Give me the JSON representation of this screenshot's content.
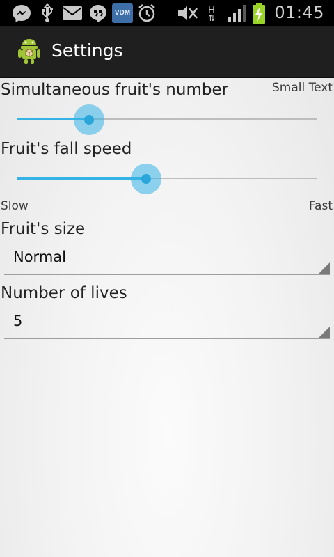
{
  "status_bar": {
    "time": "01:45",
    "icons": [
      "messenger-icon",
      "usb-icon",
      "email-icon",
      "hangouts-icon",
      "vdm-icon",
      "alarm-icon",
      "mute-icon",
      "hspa-icon",
      "signal-icon",
      "battery-charging-icon"
    ],
    "vdm_text": "VDM",
    "hspa_text": "H"
  },
  "action_bar": {
    "title": "Settings"
  },
  "settings": {
    "fruit_number": {
      "label": "Simultaneous fruit's number",
      "value_text": "Small Text",
      "level": 0.24
    },
    "fall_speed": {
      "label": "Fruit's fall speed",
      "level": 0.43,
      "min_label": "Slow",
      "max_label": "Fast"
    },
    "fruit_size": {
      "label": "Fruit's size",
      "selected": "Normal"
    },
    "lives": {
      "label": "Number of lives",
      "selected": "5"
    }
  },
  "colors": {
    "accent": "#35b3e5",
    "action_bar": "#1f1f1f",
    "status_bar": "#000000"
  }
}
